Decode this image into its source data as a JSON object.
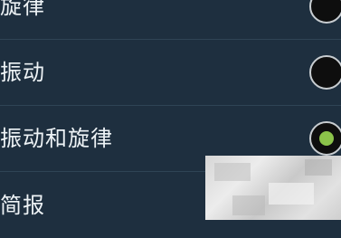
{
  "settings_list": {
    "items": [
      {
        "label": "旋律",
        "selected": false
      },
      {
        "label": "振动",
        "selected": false
      },
      {
        "label": "振动和旋律",
        "selected": true
      },
      {
        "label": "简报",
        "selected": false
      }
    ]
  },
  "colors": {
    "background": "#1e2f3f",
    "divider": "#2f4455",
    "text": "#eef3f6",
    "radio_fill": "#0e0e0e",
    "radio_border": "#c8cdd1",
    "radio_selected_dot": "#8bc34a"
  }
}
